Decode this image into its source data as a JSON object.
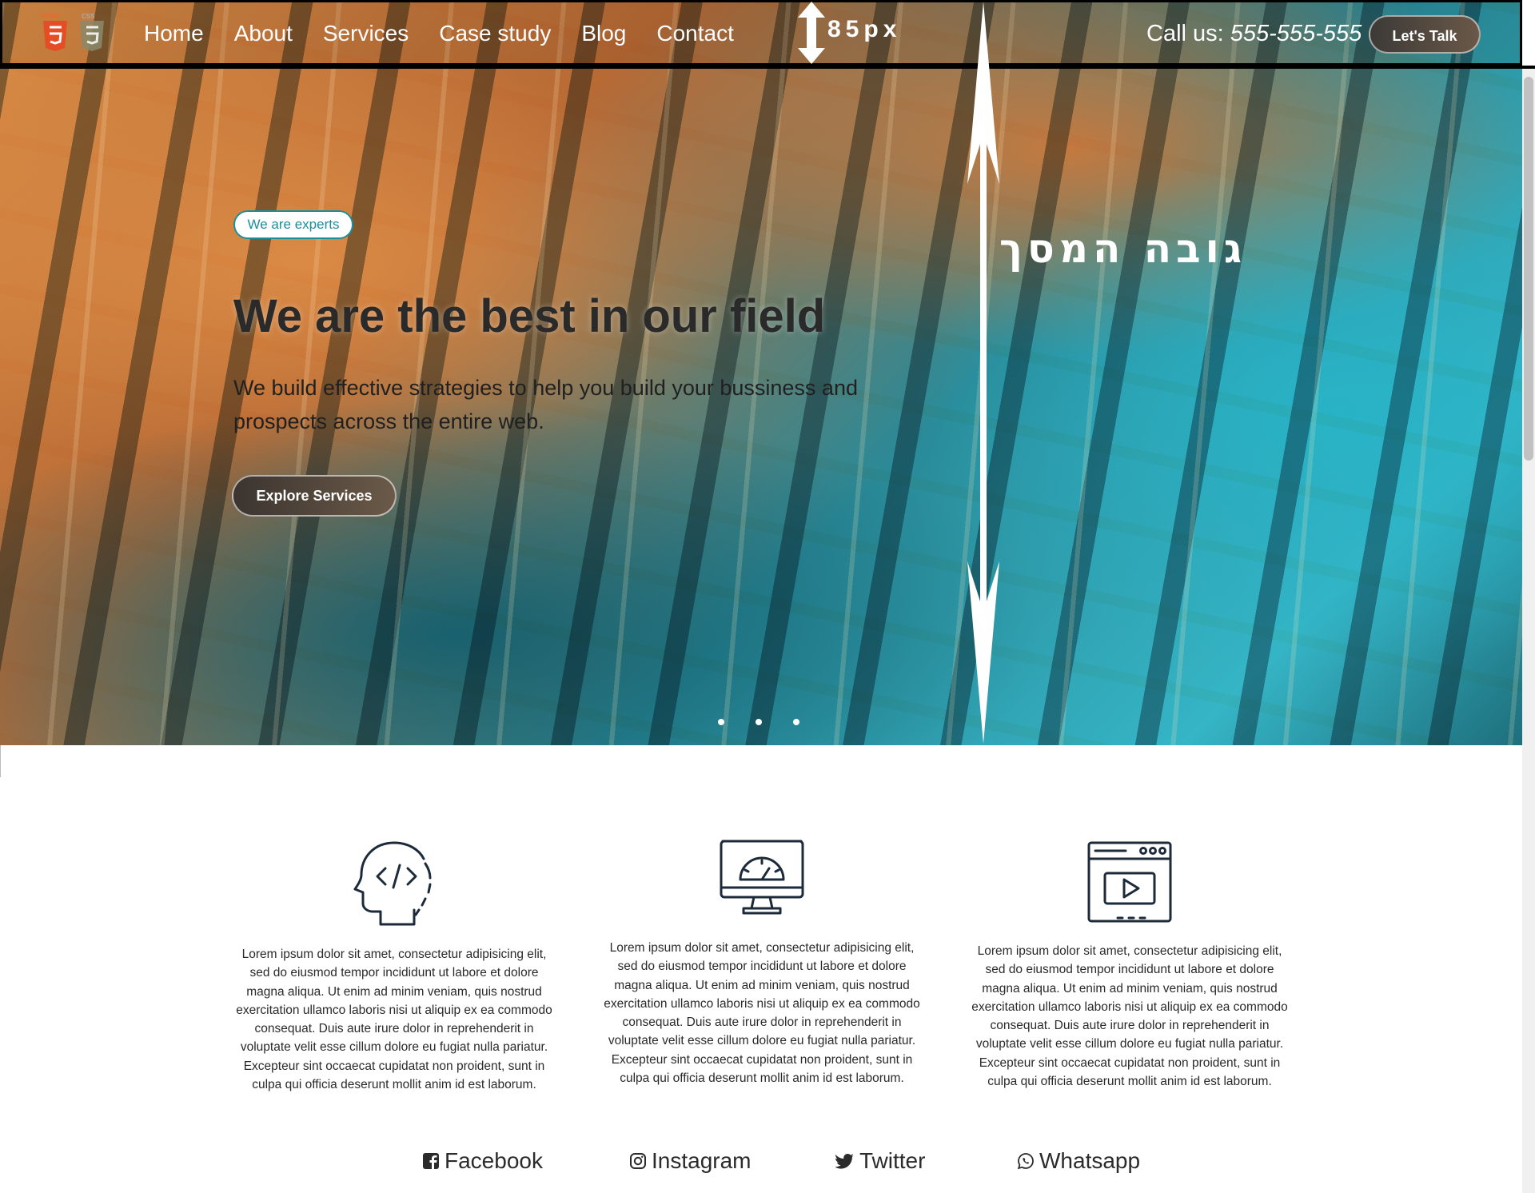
{
  "nav": {
    "links": [
      "Home",
      "About",
      "Services",
      "Case study",
      "Blog",
      "Contact"
    ],
    "measure_label": "85px",
    "call_prefix": "Call us:",
    "call_number": "555-555-555",
    "cta_label": "Let's Talk"
  },
  "hero": {
    "badge": "We are experts",
    "title": "We are the best in our field",
    "subtitle": "We build effective strategies to help you build your bussiness and prospects across the entire web.",
    "button": "Explore Services",
    "screen_height_label": "גובה המסך"
  },
  "features": [
    {
      "icon": "code-head-icon",
      "text": "Lorem ipsum dolor sit amet, consectetur adipisicing elit, sed do eiusmod tempor incididunt ut labore et dolore magna aliqua. Ut enim ad minim veniam, quis nostrud exercitation ullamco laboris nisi ut aliquip ex ea commodo consequat. Duis aute irure dolor in reprehenderit in voluptate velit esse cillum dolore eu fugiat nulla pariatur. Excepteur sint occaecat cupidatat non proident, sunt in culpa qui officia deserunt mollit anim id est laborum."
    },
    {
      "icon": "speed-monitor-icon",
      "text": "Lorem ipsum dolor sit amet, consectetur adipisicing elit, sed do eiusmod tempor incididunt ut labore et dolore magna aliqua. Ut enim ad minim veniam, quis nostrud exercitation ullamco laboris nisi ut aliquip ex ea commodo consequat. Duis aute irure dolor in reprehenderit in voluptate velit esse cillum dolore eu fugiat nulla pariatur. Excepteur sint occaecat cupidatat non proident, sunt in culpa qui officia deserunt mollit anim id est laborum."
    },
    {
      "icon": "video-window-icon",
      "text": "Lorem ipsum dolor sit amet, consectetur adipisicing elit, sed do eiusmod tempor incididunt ut labore et dolore magna aliqua. Ut enim ad minim veniam, quis nostrud exercitation ullamco laboris nisi ut aliquip ex ea commodo consequat. Duis aute irure dolor in reprehenderit in voluptate velit esse cillum dolore eu fugiat nulla pariatur. Excepteur sint occaecat cupidatat non proident, sunt in culpa qui officia deserunt mollit anim id est laborum."
    }
  ],
  "social": [
    {
      "label": "Facebook",
      "icon": "facebook-icon"
    },
    {
      "label": "Instagram",
      "icon": "instagram-icon"
    },
    {
      "label": "Twitter",
      "icon": "twitter-icon"
    },
    {
      "label": "Whatsapp",
      "icon": "whatsapp-icon"
    }
  ],
  "logo": {
    "top_labels": [
      "HTML",
      "CSS"
    ]
  },
  "colors": {
    "accent": "#1a8f9a",
    "button_dark": "#3c3a37",
    "icon_stroke": "#1c2a3a"
  }
}
